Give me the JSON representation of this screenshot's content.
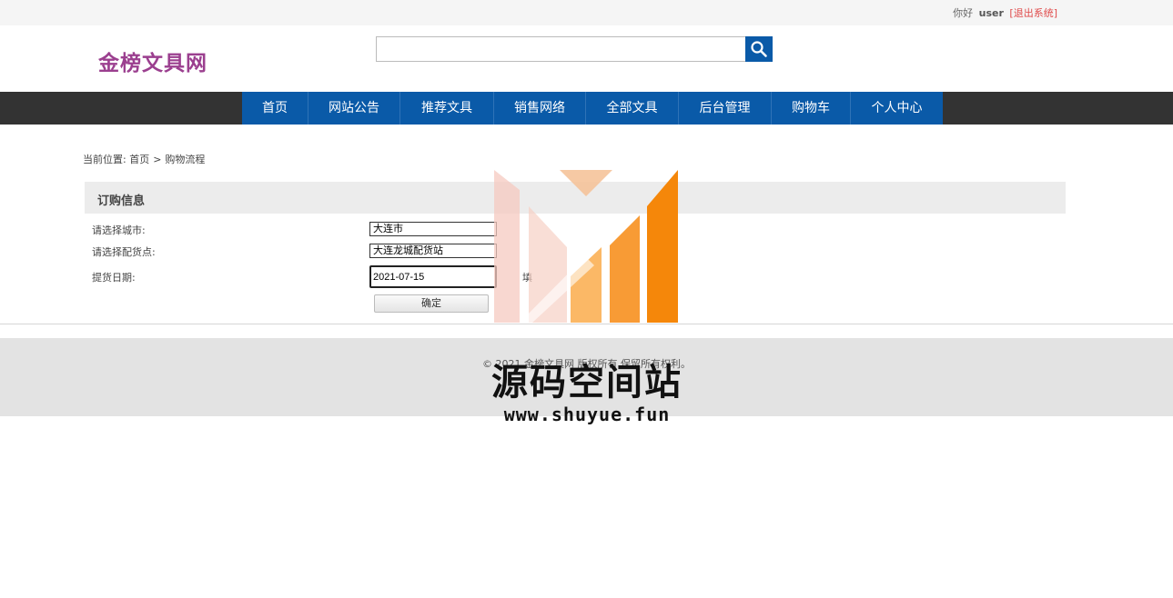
{
  "topbar": {
    "greeting": "你好",
    "username": "user",
    "logout": "[退出系统]"
  },
  "header": {
    "logo": "金榜文具网",
    "search": {
      "value": "",
      "placeholder": ""
    }
  },
  "nav": {
    "items": [
      {
        "label": "首页"
      },
      {
        "label": "网站公告"
      },
      {
        "label": "推荐文具"
      },
      {
        "label": "销售网络"
      },
      {
        "label": "全部文具"
      },
      {
        "label": "后台管理"
      },
      {
        "label": "购物车"
      },
      {
        "label": "个人中心"
      }
    ]
  },
  "breadcrumb": {
    "prefix": "当前位置: 首页",
    "separator": ">",
    "current": "购物流程"
  },
  "panel": {
    "title": "订购信息"
  },
  "form": {
    "city": {
      "label": "请选择城市:",
      "value": "大连市"
    },
    "point": {
      "label": "请选择配货点:",
      "value": "大连龙城配货站"
    },
    "date": {
      "label": "提货日期:",
      "value": "2021-07-15",
      "hint": "填"
    },
    "submit": "确定"
  },
  "footer": {
    "copyright": "© 2021 金榜文具网 版权所有 保留所有权利。",
    "sub": ""
  },
  "watermark": {
    "title": "源码空间站",
    "url": "www.shuyue.fun"
  },
  "colors": {
    "nav_blue": "#0a5aa8",
    "nav_bar": "#333333",
    "logo": "#9b3f8f",
    "logout": "#e04a4a"
  }
}
